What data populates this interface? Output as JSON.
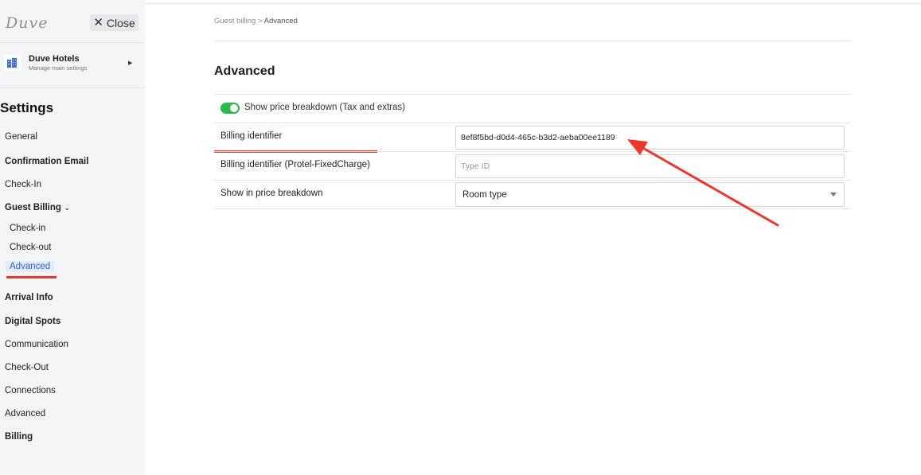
{
  "sidebar": {
    "logo": "Duve",
    "close_label": "Close",
    "hotel": {
      "name": "Duve Hotels",
      "subtitle": "Manage main settings"
    },
    "settings_title": "Settings",
    "items": [
      {
        "label": "General",
        "bold": false
      },
      {
        "label": "Confirmation Email",
        "bold": true
      },
      {
        "label": "Check-In",
        "bold": false
      },
      {
        "label": "Guest Billing",
        "bold": true
      },
      {
        "label": "Arrival Info",
        "bold": true
      },
      {
        "label": "Digital Spots",
        "bold": true
      },
      {
        "label": "Communication",
        "bold": false
      },
      {
        "label": "Check-Out",
        "bold": false
      },
      {
        "label": "Connections",
        "bold": false
      },
      {
        "label": "Advanced",
        "bold": false
      },
      {
        "label": "Billing",
        "bold": true
      }
    ],
    "guest_billing_sub": [
      {
        "label": "Check-in"
      },
      {
        "label": "Check-out"
      },
      {
        "label": "Advanced",
        "active": true
      }
    ]
  },
  "breadcrumb": {
    "parent": "Guest billing",
    "separator": ">",
    "current": "Advanced"
  },
  "main": {
    "title": "Advanced",
    "toggle": {
      "label": "Show price breakdown (Tax and extras)",
      "on": true
    },
    "fields": {
      "billing_identifier": {
        "label": "Billing identifier",
        "value": "8ef8f5bd-d0d4-465c-b3d2-aeba00ee1189"
      },
      "billing_identifier_protel": {
        "label": "Billing identifier (Protel-FixedCharge)",
        "placeholder": "Type ID",
        "value": ""
      },
      "show_in_breakdown": {
        "label": "Show in price breakdown",
        "value": "Room type"
      }
    }
  },
  "colors": {
    "annotation_red": "#e8382a",
    "toggle_green": "#2db84d",
    "active_blue": "#2a62c9"
  }
}
